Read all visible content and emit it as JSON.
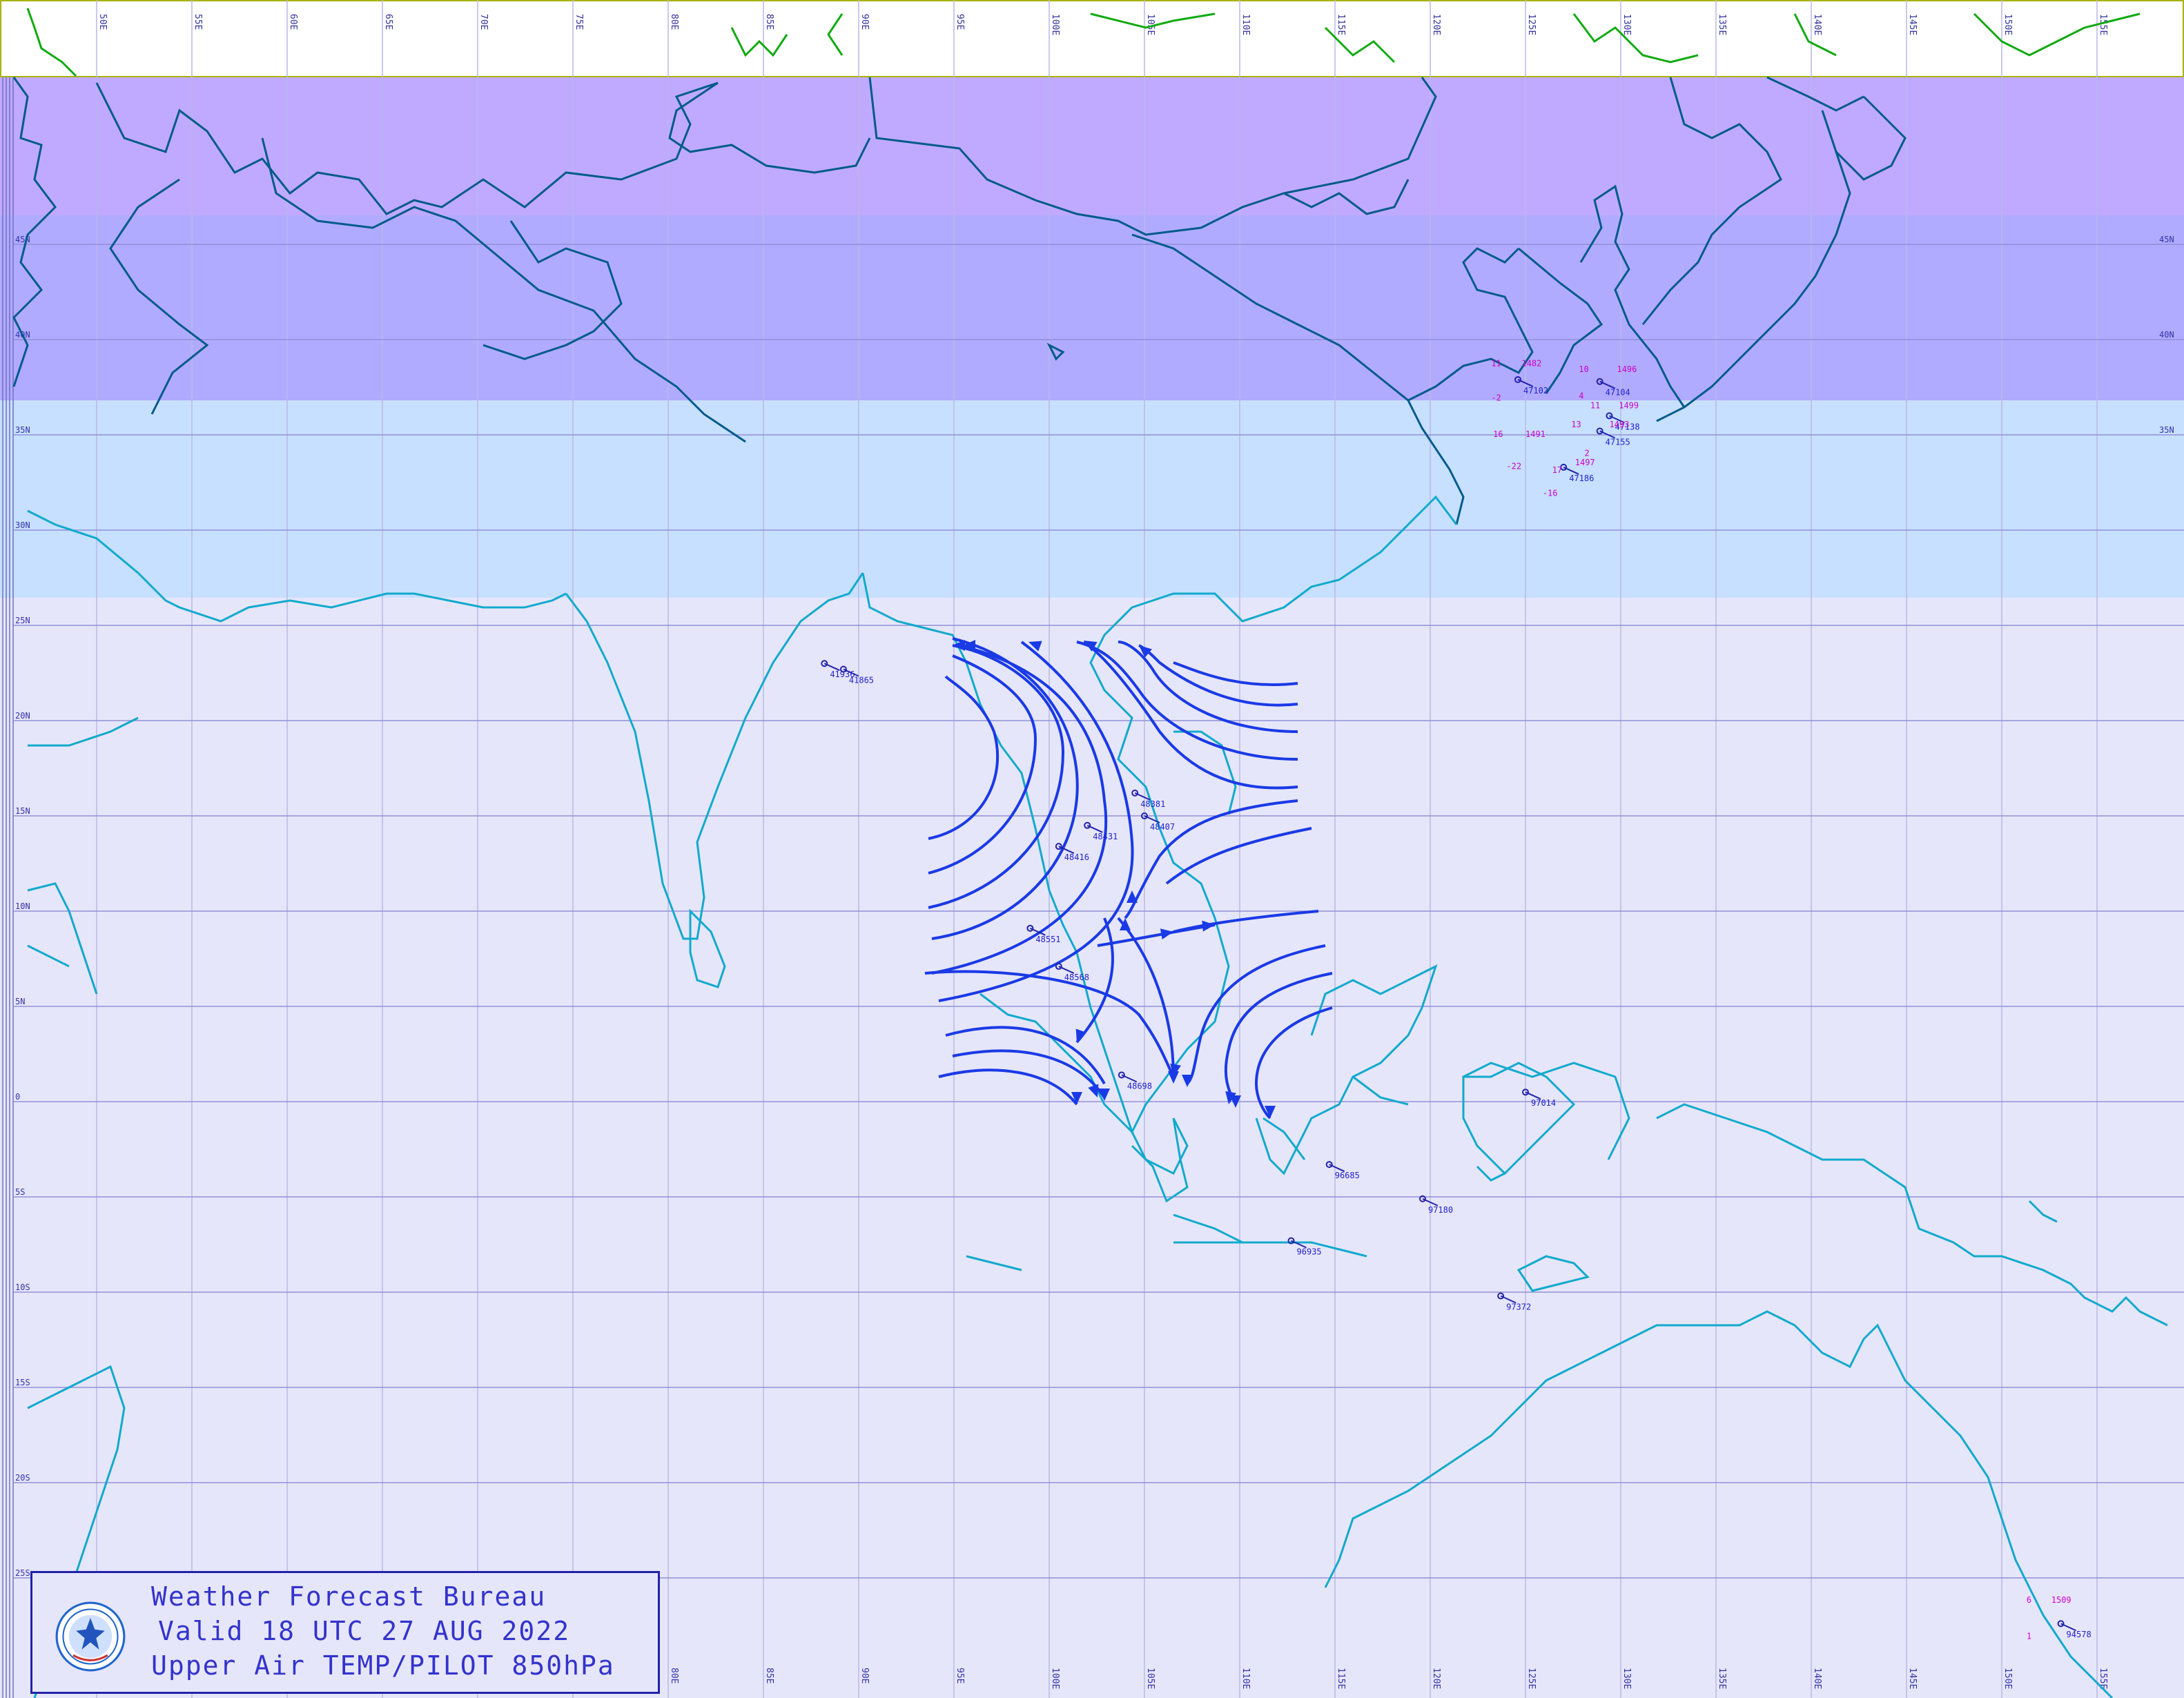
{
  "legend": {
    "bureau": "Weather Forecast Bureau",
    "valid": "Valid 18 UTC 27 AUG 2022",
    "product": "Upper Air TEMP/PILOT 850hPa"
  },
  "colors": {
    "background": "#e6e6fa",
    "band_purple": "#c0aaff",
    "band_violet": "#b1abff",
    "band_lightblue": "#c7e0ff",
    "band_white": "#ffffff",
    "coast_north": "#005a8c",
    "coast_south": "#11aacc",
    "coast_top": "#11aa11",
    "streamline": "#1a3ae6",
    "station_text": "#2222cc",
    "value_text": "#cc00cc"
  },
  "icons": {
    "logo": "meteorological-department-seal-icon"
  },
  "grid": {
    "top_lon_labels": [
      "50E",
      "55E",
      "60E",
      "65E",
      "70E",
      "75E",
      "80E",
      "85E",
      "90E",
      "95E",
      "100E",
      "105E",
      "110E",
      "115E",
      "120E",
      "125E",
      "130E",
      "135E",
      "140E",
      "145E",
      "150E",
      "155E"
    ],
    "bottom_lon_labels": [
      "80E",
      "85E",
      "90E",
      "95E",
      "100E",
      "105E",
      "110E",
      "115E",
      "120E",
      "125E",
      "130E",
      "135E",
      "140E",
      "145E",
      "150E",
      "155E"
    ],
    "lat_labels": [
      "45N",
      "40N",
      "35N",
      "30N",
      "25N",
      "20N",
      "15N",
      "10N",
      "5N",
      "0",
      "5S",
      "10S",
      "15S",
      "20S",
      "25S"
    ]
  },
  "stations": [
    {
      "id": "48381",
      "lon": 104.5,
      "lat": 16.2
    },
    {
      "id": "48407",
      "lon": 105.0,
      "lat": 15.0
    },
    {
      "id": "48431",
      "lon": 102.0,
      "lat": 14.5
    },
    {
      "id": "48416",
      "lon": 100.5,
      "lat": 13.4
    },
    {
      "id": "48551",
      "lon": 99.0,
      "lat": 9.1
    },
    {
      "id": "48568",
      "lon": 100.5,
      "lat": 7.1
    },
    {
      "id": "48698",
      "lon": 103.8,
      "lat": 1.4
    },
    {
      "id": "41936",
      "lon": 88.2,
      "lat": 23.0
    },
    {
      "id": "41865",
      "lon": 89.2,
      "lat": 22.7
    },
    {
      "id": "96685",
      "lon": 114.7,
      "lat": -3.3
    },
    {
      "id": "97180",
      "lon": 119.6,
      "lat": -5.1
    },
    {
      "id": "96935",
      "lon": 112.7,
      "lat": -7.3
    },
    {
      "id": "97014",
      "lon": 125.0,
      "lat": 0.5
    },
    {
      "id": "97372",
      "lon": 123.7,
      "lat": -10.2
    },
    {
      "id": "47102",
      "lon": 124.6,
      "lat": 37.9
    },
    {
      "id": "47104",
      "lon": 128.9,
      "lat": 37.8
    },
    {
      "id": "47138",
      "lon": 129.4,
      "lat": 36.0
    },
    {
      "id": "47155",
      "lon": 128.9,
      "lat": 35.2
    },
    {
      "id": "47186",
      "lon": 127.0,
      "lat": 33.3
    },
    {
      "id": "94578",
      "lon": 153.1,
      "lat": -27.4
    }
  ],
  "observations": [
    {
      "text": "11",
      "lon": 123.2,
      "lat": 38.6
    },
    {
      "text": "-2",
      "lon": 123.2,
      "lat": 36.8
    },
    {
      "text": "1482",
      "lon": 124.8,
      "lat": 38.6
    },
    {
      "text": "10",
      "lon": 127.8,
      "lat": 38.3
    },
    {
      "text": "1496",
      "lon": 129.8,
      "lat": 38.3
    },
    {
      "text": "4",
      "lon": 127.8,
      "lat": 36.9
    },
    {
      "text": "11",
      "lon": 128.4,
      "lat": 36.4
    },
    {
      "text": "1499",
      "lon": 129.9,
      "lat": 36.4
    },
    {
      "text": "13",
      "lon": 127.4,
      "lat": 35.4
    },
    {
      "text": "1493",
      "lon": 129.4,
      "lat": 35.4
    },
    {
      "text": "16",
      "lon": 123.3,
      "lat": 34.9
    },
    {
      "text": "1491",
      "lon": 125.0,
      "lat": 34.9
    },
    {
      "text": "-22",
      "lon": 124.0,
      "lat": 33.2
    },
    {
      "text": "1497",
      "lon": 127.6,
      "lat": 33.4
    },
    {
      "text": "-16",
      "lon": 125.9,
      "lat": 31.8
    },
    {
      "text": "17",
      "lon": 126.4,
      "lat": 33.0
    },
    {
      "text": "2",
      "lon": 128.1,
      "lat": 33.9
    },
    {
      "text": "6",
      "lon": 151.3,
      "lat": -26.3
    },
    {
      "text": "1509",
      "lon": 152.6,
      "lat": -26.3
    },
    {
      "text": "1",
      "lon": 151.3,
      "lat": -28.2
    }
  ]
}
